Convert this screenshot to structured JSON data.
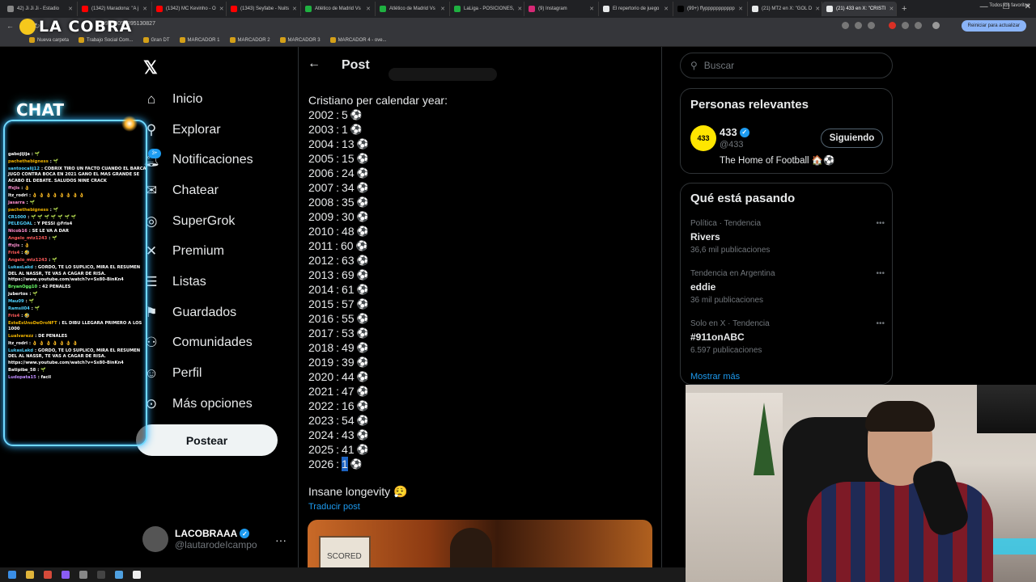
{
  "browser": {
    "tabs": [
      {
        "label": "42) Ji Ji Ji - Estadio",
        "color": "#888888",
        "active": false
      },
      {
        "label": "(1342) Maradona: \"A j",
        "color": "#ff0000",
        "active": false
      },
      {
        "label": "(1342) MC Kevinho - O",
        "color": "#ff0000",
        "active": false
      },
      {
        "label": "(1343) Seyfabe - Nuits",
        "color": "#ff0000",
        "active": false
      },
      {
        "label": "Atlético de Madrid Vs",
        "color": "#1fb141",
        "active": false
      },
      {
        "label": "Atlético de Madrid Vs",
        "color": "#1fb141",
        "active": false
      },
      {
        "label": "LaLiga - POSICIONES,",
        "color": "#1fb141",
        "active": false
      },
      {
        "label": "(9) Instagram",
        "color": "#d62976",
        "active": false
      },
      {
        "label": "El repertorio de juego",
        "color": "#e7e9ea",
        "active": false
      },
      {
        "label": "(99+) ffyppppppppppp",
        "color": "#000000",
        "active": false
      },
      {
        "label": "(21) MT2 en X: \"GOL D",
        "color": "#e7e9ea",
        "active": false
      },
      {
        "label": "(21) 433 en X: \"CRISTI",
        "color": "#e7e9ea",
        "active": true
      }
    ],
    "url": "2009343058895130827",
    "update_button": "Reiniciar para actualizar",
    "bookmarks": [
      "Nueva carpeta",
      "Trabajo Social Com...",
      "Gran DT",
      "MARCADOR 1",
      "MARCADOR 2",
      "MARCADOR 3",
      "MARCADOR 4 - ove..."
    ],
    "all_bookmarks": "Todos los favoritos"
  },
  "stream": {
    "logo_text": "LA COBRA",
    "chat_title": "CHAT",
    "chat_badge": "3+",
    "chat": [
      {
        "user": "gabojijija",
        "color": "#ffffff",
        "text": ": 🌱"
      },
      {
        "user": "pachethebigness",
        "color": "#f0b400",
        "text": ": 🌱"
      },
      {
        "user": "santoocalij12",
        "color": "#4fd1ff",
        "text": ": COBRIX TIRO UN FACTO CUANDO EL BARCA JUGO CONTRA BOCA EN 2021 GANO EL MAS GRANDE SE ACABO EL DEBATE. SALUDOS NINE CRACK"
      },
      {
        "user": "ffxjis",
        "color": "#ff8fd0",
        "text": ": 👌"
      },
      {
        "user": "ltz_rodri",
        "color": "#ffffff",
        "text": ": 👌 👌 👌 👌 👌 👌 👌 👌"
      },
      {
        "user": "Jasarra",
        "color": "#ff8fd0",
        "text": ": 🌱"
      },
      {
        "user": "pachethebigness",
        "color": "#f0b400",
        "text": ": 🌱"
      },
      {
        "user": "CR1000",
        "color": "#4fd1ff",
        "text": ": 🌱 🌱 🌱 🌱 🌱 🌱 🌱"
      },
      {
        "user": "PELEGOAL",
        "color": "#4fd1ff",
        "text": ": Y PESSI @Fris4"
      },
      {
        "user": "Nicob16",
        "color": "#ff8fd0",
        "text": ": SE LE VA A DAR"
      },
      {
        "user": "Angelo_mtz1243",
        "color": "#ff5a5a",
        "text": ": 🌱"
      },
      {
        "user": "ffxjis",
        "color": "#ff8fd0",
        "text": ": 👌"
      },
      {
        "user": "Fris4",
        "color": "#ff5a5a",
        "text": ": 🤣"
      },
      {
        "user": "Angelo_mtz1243",
        "color": "#ff5a5a",
        "text": ": 🌱"
      },
      {
        "user": "LukasLakd",
        "color": "#4fd1ff",
        "text": ": GORDO, TE LO SUPLICO, MIRA EL RESUMEN DEL AL NASSR, TE VAS A CAGAR DE RISA. https://www.youtube.com/watch?v=Sx80-BinKn4"
      },
      {
        "user": "BryanOgg10",
        "color": "#6aff6a",
        "text": ": 42 PENALES"
      },
      {
        "user": "jubertos",
        "color": "#ffffff",
        "text": ": 🌱"
      },
      {
        "user": "Mau09",
        "color": "#4fd1ff",
        "text": ": 🌱"
      },
      {
        "user": "Ramsil04",
        "color": "#4fd1ff",
        "text": ": 🌱"
      },
      {
        "user": "Fris4",
        "color": "#ff5a5a",
        "text": ": 🤣"
      },
      {
        "user": "EsteEsUnoDeOroNFT",
        "color": "#f0b400",
        "text": ": EL DIBU LLEGARA PRIMERO A LOS 1000"
      },
      {
        "user": "Lualvarezz",
        "color": "#f0b400",
        "text": ": DE PENALES"
      },
      {
        "user": "ltz_rodri",
        "color": "#ffffff",
        "text": ": 👌 👌 👌 👌 👌 👌 👌"
      },
      {
        "user": "LukasLakd",
        "color": "#4fd1ff",
        "text": ": GORDO, TE LO SUPLICO, MIRA EL RESUMEN DEL AL NASSR, TE VAS A CAGAR DE RISA. https://www.youtube.com/watch?v=Sx80-BinKn4"
      },
      {
        "user": "Batipibe_58",
        "color": "#ffffff",
        "text": ": 🌱"
      },
      {
        "user": "Ludopata15",
        "color": "#c08cff",
        "text": ": facil"
      }
    ]
  },
  "nav": {
    "logo": "𝕏",
    "items": [
      {
        "id": "home",
        "icon": "home-icon",
        "glyph": "⌂",
        "label": "Inicio"
      },
      {
        "id": "explore",
        "icon": "search-icon",
        "glyph": "⚲",
        "label": "Explorar"
      },
      {
        "id": "notifications",
        "icon": "bell-icon",
        "glyph": "🔔︎",
        "label": "Notificaciones"
      },
      {
        "id": "chat",
        "icon": "message-icon",
        "glyph": "✉",
        "label": "Chatear"
      },
      {
        "id": "supergrok",
        "icon": "grok-icon",
        "glyph": "◎",
        "label": "SuperGrok"
      },
      {
        "id": "premium",
        "icon": "x-premium-icon",
        "glyph": "✕",
        "label": "Premium"
      },
      {
        "id": "lists",
        "icon": "list-icon",
        "glyph": "☰",
        "label": "Listas"
      },
      {
        "id": "bookmarks",
        "icon": "bookmark-icon",
        "glyph": "⚑",
        "label": "Guardados"
      },
      {
        "id": "communities",
        "icon": "people-icon",
        "glyph": "⚇",
        "label": "Comunidades"
      },
      {
        "id": "profile",
        "icon": "user-icon",
        "glyph": "☺",
        "label": "Perfil"
      },
      {
        "id": "more",
        "icon": "more-circle-icon",
        "glyph": "⊙",
        "label": "Más opciones"
      }
    ],
    "post_button": "Postear",
    "account": {
      "name": "LACOBRAAA",
      "handle": "@lautarodeIcampo",
      "more": "···"
    }
  },
  "post": {
    "back": "←",
    "title": "Post",
    "intro": "Cristiano per calendar year:",
    "years": [
      {
        "year": "2002",
        "goals": "5"
      },
      {
        "year": "2003",
        "goals": "1"
      },
      {
        "year": "2004",
        "goals": "13"
      },
      {
        "year": "2005",
        "goals": "15"
      },
      {
        "year": "2006",
        "goals": "24"
      },
      {
        "year": "2007",
        "goals": "34"
      },
      {
        "year": "2008",
        "goals": "35"
      },
      {
        "year": "2009",
        "goals": "30"
      },
      {
        "year": "2010",
        "goals": "48"
      },
      {
        "year": "2011",
        "goals": "60"
      },
      {
        "year": "2012",
        "goals": "63"
      },
      {
        "year": "2013",
        "goals": "69"
      },
      {
        "year": "2014",
        "goals": "61"
      },
      {
        "year": "2015",
        "goals": "57"
      },
      {
        "year": "2016",
        "goals": "55"
      },
      {
        "year": "2017",
        "goals": "53"
      },
      {
        "year": "2018",
        "goals": "49"
      },
      {
        "year": "2019",
        "goals": "39"
      },
      {
        "year": "2020",
        "goals": "44"
      },
      {
        "year": "2021",
        "goals": "47"
      },
      {
        "year": "2022",
        "goals": "16"
      },
      {
        "year": "2023",
        "goals": "54"
      },
      {
        "year": "2024",
        "goals": "43"
      },
      {
        "year": "2025",
        "goals": "41"
      },
      {
        "year": "2026",
        "goals": "1"
      }
    ],
    "ball": "⚽",
    "footer": "Insane longevity 😮‍💨",
    "translate": "Traducir post",
    "media_text": "SCORED"
  },
  "sidebar": {
    "search_placeholder": "Buscar",
    "people_title": "Personas relevantes",
    "person": {
      "avatar_text": "433",
      "name": "433",
      "handle": "@433",
      "bio": "The Home of Football 🏠⚽",
      "follow": "Siguiendo"
    },
    "trends_title": "Qué está pasando",
    "trends": [
      {
        "meta": "Política · Tendencia",
        "name": "Rivers",
        "count": "36,6 mil publicaciones"
      },
      {
        "meta": "Tendencia en Argentina",
        "name": "eddie",
        "count": "36 mil publicaciones"
      },
      {
        "meta": "Solo en X · Tendencia",
        "name": "#911onABC",
        "count": "6.597 publicaciones"
      }
    ],
    "show_more": "Mostrar más"
  },
  "colors": {
    "accent": "#1d9bf0",
    "background": "#000000",
    "text": "#e7e9ea",
    "muted": "#71767b",
    "chat_neon": "#6fd8ff"
  }
}
